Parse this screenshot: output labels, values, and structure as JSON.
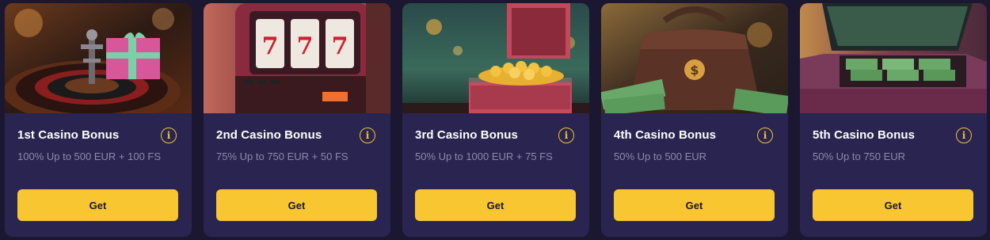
{
  "colors": {
    "page_background": "#1b1730",
    "card_background": "#2a2550",
    "button_background": "#f7c631",
    "info_icon": "#f2c230",
    "description_text": "#8e89ad"
  },
  "bonuses": [
    {
      "title": "1st Casino Bonus",
      "description": "100% Up to 500 EUR + 100 FS",
      "button_label": "Get",
      "info_icon": "info-icon",
      "image": "roulette-gift"
    },
    {
      "title": "2nd Casino Bonus",
      "description": "75% Up to 750 EUR + 50 FS",
      "button_label": "Get",
      "info_icon": "info-icon",
      "image": "slot-machine"
    },
    {
      "title": "3rd Casino Bonus",
      "description": "50% Up to 1000 EUR + 75 FS",
      "button_label": "Get",
      "info_icon": "info-icon",
      "image": "treasure-chest"
    },
    {
      "title": "4th Casino Bonus",
      "description": "50% Up to 500 EUR",
      "button_label": "Get",
      "info_icon": "info-icon",
      "image": "money-bag"
    },
    {
      "title": "5th Casino Bonus",
      "description": "50% Up to 750 EUR",
      "button_label": "Get",
      "info_icon": "info-icon",
      "image": "car-trunk-cash"
    }
  ]
}
